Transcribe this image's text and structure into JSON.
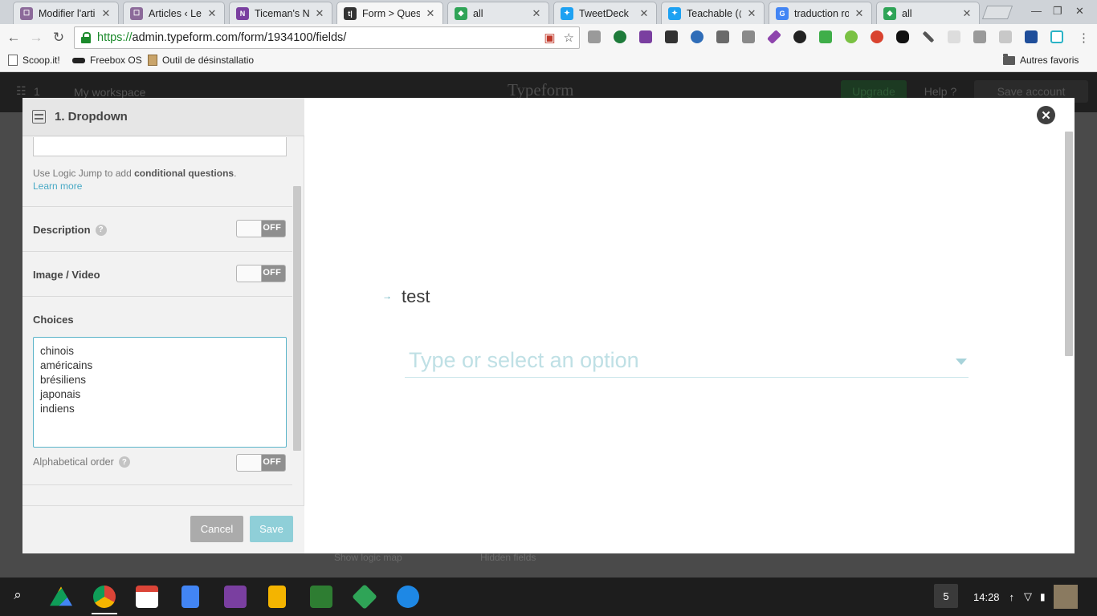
{
  "browser": {
    "tabs": [
      {
        "title": "Modifier l'artic",
        "color": "#8c6a9a",
        "glyph": "☐"
      },
      {
        "title": "Articles ‹ Le p",
        "color": "#8c6a9a",
        "glyph": "☐"
      },
      {
        "title": "Ticeman's No",
        "color": "#7a3fa0",
        "glyph": "N"
      },
      {
        "title": "Form > Quest",
        "color": "#333333",
        "glyph": "t|"
      },
      {
        "title": "all",
        "color": "#2fa457",
        "glyph": "◆"
      },
      {
        "title": "TweetDeck",
        "color": "#1da1f2",
        "glyph": "✦"
      },
      {
        "title": "Teachable (@",
        "color": "#1da1f2",
        "glyph": "✦"
      },
      {
        "title": "traduction rou",
        "color": "#4285f4",
        "glyph": "G"
      },
      {
        "title": "all",
        "color": "#2fa457",
        "glyph": "◆"
      }
    ],
    "url_scheme": "https://",
    "url_host": "admin.typeform.com",
    "url_path": "/form/1934100/fields/",
    "bookmarks": [
      "Scoop.it!",
      "Freebox OS",
      "Outil de désinstallatio"
    ],
    "other_bookmarks": "Autres favoris"
  },
  "backdrop": {
    "workspace_count": "1",
    "workspace": "My workspace",
    "brand": "Typeform",
    "upgrade": "Upgrade",
    "help": "Help ?",
    "save_account": "Save account",
    "show_logic_map": "Show logic map",
    "hidden_fields": "Hidden fields"
  },
  "editor": {
    "question_title": "1. Dropdown",
    "logic_hint_prefix": "Use Logic Jump to add ",
    "logic_hint_bold": "conditional questions",
    "logic_hint_suffix": ".",
    "learn_more": "Learn more",
    "description_label": "Description",
    "image_video_label": "Image / Video",
    "choices_label": "Choices",
    "choices": [
      "chinois",
      "américains",
      "brésiliens",
      "japonais",
      "indiens"
    ],
    "alphabetical_label": "Alphabetical order",
    "toggle_off": "OFF",
    "cancel": "Cancel",
    "save": "Save"
  },
  "preview": {
    "question": "test",
    "placeholder": "Type or select an option"
  },
  "shelf": {
    "notification_count": "5",
    "time": "14:28"
  },
  "colors": {
    "accent": "#5bb4c9",
    "save_button": "#8fcfd8",
    "url_green": "#1c8a2c"
  }
}
